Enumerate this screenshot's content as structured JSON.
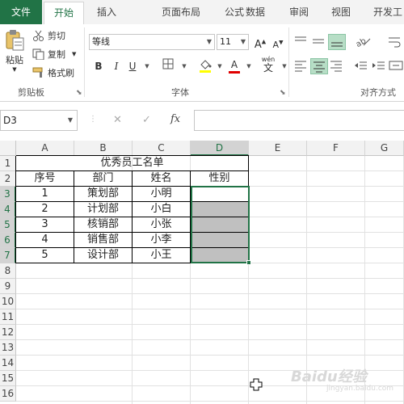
{
  "ribbon": {
    "tabs": [
      {
        "label": "文件"
      },
      {
        "label": "开始"
      },
      {
        "label": "插入"
      },
      {
        "label": "页面布局"
      },
      {
        "label": "公式"
      },
      {
        "label": "数据"
      },
      {
        "label": "审阅"
      },
      {
        "label": "视图"
      },
      {
        "label": "开发工"
      }
    ],
    "clipboard": {
      "paste": "粘贴",
      "cut": "剪切",
      "copy": "复制",
      "format_painter": "格式刷",
      "group": "剪贴板"
    },
    "font": {
      "name": "等线",
      "size": "11",
      "bold": "B",
      "italic": "I",
      "underline": "U",
      "group": "字体",
      "wen": "wén",
      "wen_char": "文"
    },
    "alignment": {
      "group": "对齐方式"
    }
  },
  "formula_bar": {
    "name_box": "D3",
    "fx": "fx",
    "cancel": "✕",
    "enter": "✓",
    "formula": ""
  },
  "sheet": {
    "columns": [
      "A",
      "B",
      "C",
      "D",
      "E",
      "F",
      "G"
    ],
    "rows": [
      "1",
      "2",
      "3",
      "4",
      "5",
      "6",
      "7",
      "8",
      "9",
      "10",
      "11",
      "12",
      "13",
      "14",
      "15",
      "16"
    ],
    "title": "优秀员工名单",
    "headers": [
      "序号",
      "部门",
      "姓名",
      "性别"
    ],
    "data": [
      [
        "1",
        "策划部",
        "小明",
        ""
      ],
      [
        "2",
        "计划部",
        "小白",
        ""
      ],
      [
        "3",
        "核销部",
        "小张",
        ""
      ],
      [
        "4",
        "销售部",
        "小李",
        ""
      ],
      [
        "5",
        "设计部",
        "小王",
        ""
      ]
    ],
    "selected_cell": "D3"
  },
  "colors": {
    "accent": "#217346",
    "selection_fill": "#c0c0c0"
  },
  "watermark": {
    "main": "Baidu经验",
    "sub": "jingyan.baidu.com"
  }
}
